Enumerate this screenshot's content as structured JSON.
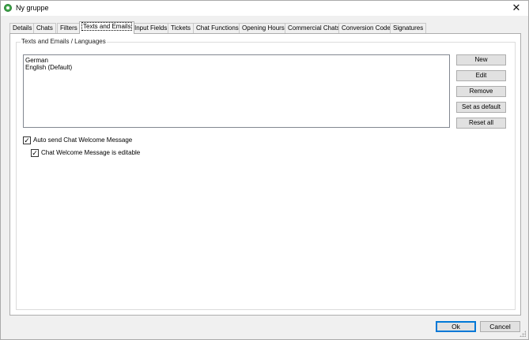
{
  "window": {
    "title": "Ny gruppe",
    "close_symbol": "✕",
    "icon": "app-logo-icon"
  },
  "tabs": [
    {
      "label": "Details"
    },
    {
      "label": "Chats"
    },
    {
      "label": "Filters"
    },
    {
      "label": "Texts and Emails",
      "active": true
    },
    {
      "label": "Input Fields"
    },
    {
      "label": "Tickets"
    },
    {
      "label": "Chat Functions"
    },
    {
      "label": "Opening Hours"
    },
    {
      "label": "Commercial Chats"
    },
    {
      "label": "Conversion Code"
    },
    {
      "label": "Signatures"
    }
  ],
  "group": {
    "label": "Texts and Emails / Languages",
    "languages": [
      "German",
      "English (Default)"
    ],
    "buttons": {
      "new": "New",
      "edit": "Edit",
      "remove": "Remove",
      "set_default": "Set as default",
      "reset_all": "Reset all"
    }
  },
  "options": {
    "auto_send": {
      "label": "Auto send Chat Welcome Message",
      "checked": true,
      "mark": "✓"
    },
    "editable": {
      "label": "Chat Welcome Message is editable",
      "checked": true,
      "mark": "✓"
    }
  },
  "footer": {
    "ok": "Ok",
    "cancel": "Cancel"
  }
}
